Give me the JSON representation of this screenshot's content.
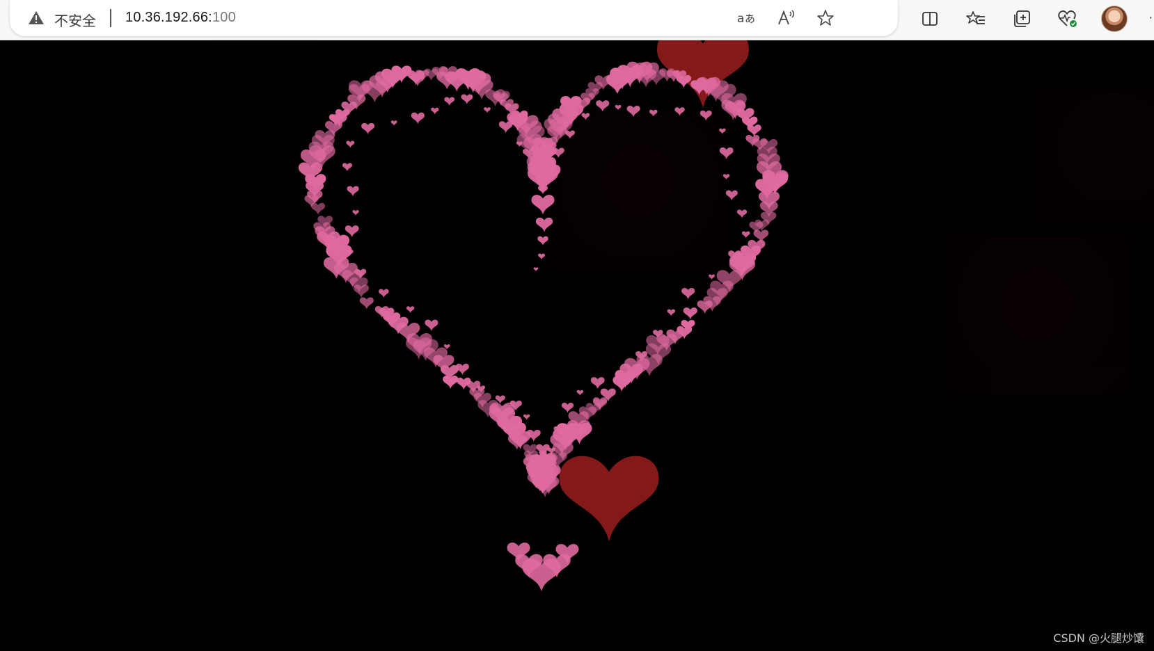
{
  "browser": {
    "security_label": "不安全",
    "url_host": "10.36.192.66:",
    "url_port": "100",
    "icons": {
      "warning": "warning-triangle-icon",
      "translate": "translate-icon",
      "read_aloud": "read-aloud-icon",
      "favorite": "star-icon",
      "split_screen": "split-screen-icon",
      "favorites": "favorites-list-icon",
      "collections": "collections-icon",
      "browser_essentials": "heartbeat-icon"
    }
  },
  "page": {
    "background": "#000000",
    "heart_pink": "#e06aa0",
    "heart_red": "#8b1a1a",
    "watermark": "CSDN @火腿炒馕"
  }
}
